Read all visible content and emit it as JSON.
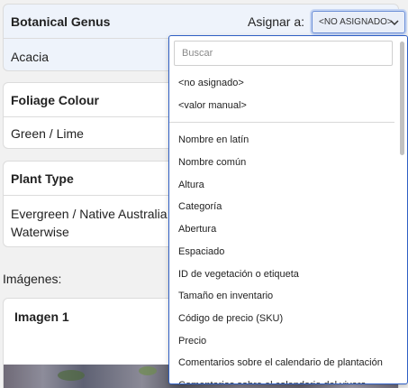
{
  "fields": [
    {
      "title": "Botanical Genus",
      "value": "Acacia"
    },
    {
      "title": "Foliage Colour",
      "value": "Green / Lime"
    },
    {
      "title": "Plant Type",
      "value": "Evergreen / Native Australia",
      "value2": "Waterwise"
    }
  ],
  "assign": {
    "label": "Asignar a:",
    "selected": "<NO ASIGNADO>"
  },
  "images": {
    "section_label": "Imágenes:",
    "card_title": "Imagen 1"
  },
  "dropdown": {
    "search_placeholder": "Buscar",
    "special_options": [
      "<no asignado>",
      "<valor manual>"
    ],
    "options": [
      "Nombre en latín",
      "Nombre común",
      "Altura",
      "Categoría",
      "Abertura",
      "Espaciado",
      "ID de vegetación o etiqueta",
      "Tamaño en inventario",
      "Código de precio (SKU)",
      "Precio",
      "Comentarios sobre el calendario de plantación",
      "Comentarios sobre el calendario del vivero"
    ]
  },
  "colors": {
    "accent": "#2f5fc4",
    "highlight_card": "#eef3fb",
    "page_bg": "#f1f1f1"
  },
  "icons": {
    "select_chevron": "chevron-down-icon"
  }
}
